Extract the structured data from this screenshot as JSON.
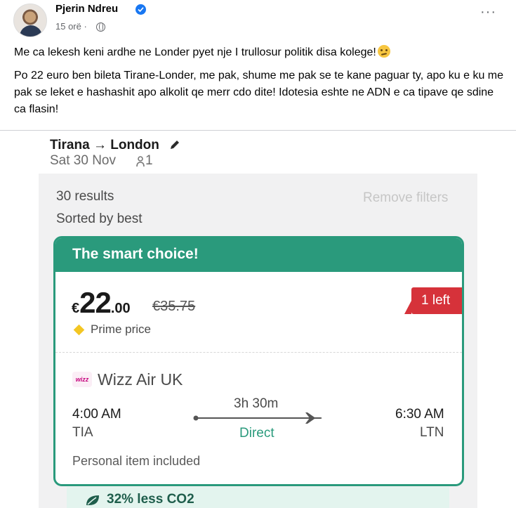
{
  "post": {
    "author": "Pjerin Ndreu",
    "time": "15 orë ·",
    "line1": "Me ca lekesh keni ardhe ne Londer pyet nje I trullosur politik disa kolege!",
    "line2": "Po 22 euro ben bileta Tirane-Londer, me pak, shume me pak se te kane paguar ty, apo ku e ku me  pak se leket e  hashashit  apo alkolit qe merr cdo dite! Idotesia eshte ne ADN e ca tipave qe sdine ca flasin!"
  },
  "booking": {
    "route": "Tirana → London",
    "date": "Sat 30 Nov",
    "passengers": "1",
    "results": "30 results",
    "remove_filters": "Remove filters",
    "sorted": "Sorted by best",
    "card_title": "The smart choice!",
    "currency": "€",
    "price_whole": "22",
    "price_decimal": ".00",
    "old_price": "€35.75",
    "prime": "Prime price",
    "badge": "1 left",
    "airline_logo": "wizz",
    "airline": "Wizz Air UK",
    "dep_time": "4:00 AM",
    "dep_code": "TIA",
    "duration": "3h 30m",
    "stops": "Direct",
    "arr_time": "6:30 AM",
    "arr_code": "LTN",
    "personal": "Personal item included",
    "co2": "32% less CO2"
  },
  "colors": {
    "accent": "#2a9a7c",
    "badge": "#d6323a",
    "link_blue": "#1877f2"
  }
}
